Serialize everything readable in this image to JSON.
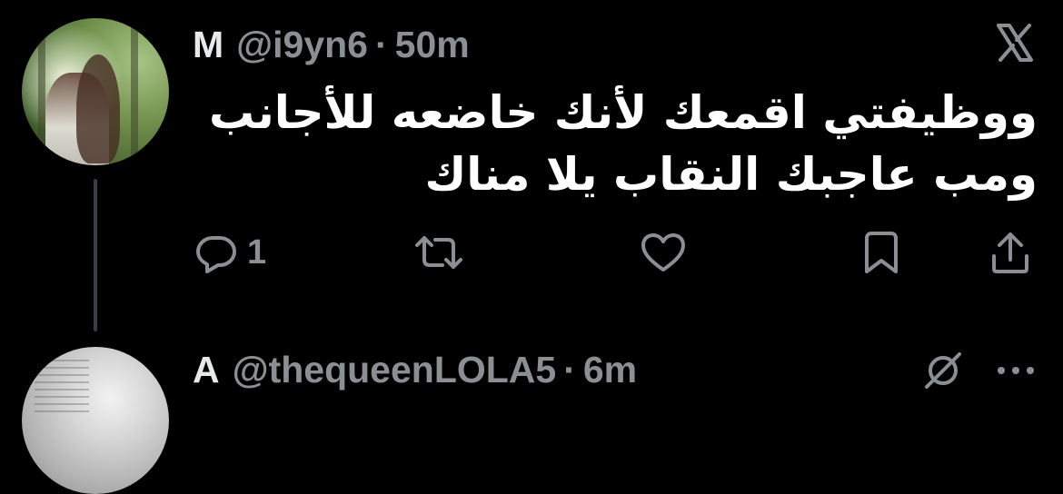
{
  "tweet": {
    "author_name": "M",
    "handle": "@i9yn6",
    "separator": "·",
    "time": "50m",
    "text_lines": [
      "ووظيفتي اقمعك لأنك خاضعه للأجانب",
      "ومب عاجبك النقاب يلا مناك"
    ],
    "reply_count": "1",
    "icons": {
      "platform": "x-logo-icon",
      "reply": "reply-icon",
      "retweet": "retweet-icon",
      "like": "heart-icon",
      "bookmark": "bookmark-icon",
      "share": "share-icon"
    }
  },
  "reply_preview": {
    "author_name": "A",
    "handle": "@thequeenLOLA5",
    "separator": "·",
    "time": "6m",
    "icons": {
      "grok": "grok-icon",
      "more": "more-icon"
    }
  },
  "colors": {
    "background": "#000000",
    "primary_text": "#e7e9ea",
    "secondary_text": "#8b8f94",
    "thread_line": "#3a3d41"
  }
}
